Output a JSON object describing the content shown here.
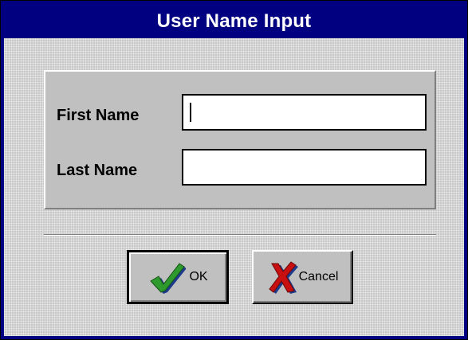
{
  "window": {
    "title": "User Name Input"
  },
  "form": {
    "first_name_label": "First Name",
    "first_name_value": "",
    "last_name_label": "Last Name",
    "last_name_value": ""
  },
  "buttons": {
    "ok_label": "OK",
    "ok_icon": "green-checkmark-icon",
    "cancel_label": "Cancel",
    "cancel_icon": "red-x-icon"
  },
  "colors": {
    "titlebar": "#000080",
    "face": "#c0c0c0",
    "check": "#2e9a2e",
    "x_mark": "#c81010"
  }
}
